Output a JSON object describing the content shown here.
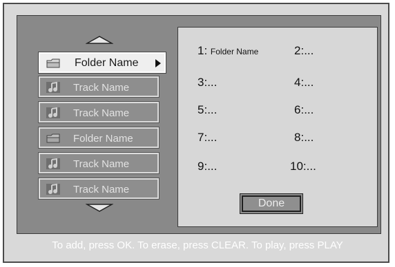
{
  "list": {
    "items": [
      {
        "type": "folder",
        "label": "Folder Name",
        "selected": true
      },
      {
        "type": "track",
        "label": "Track Name"
      },
      {
        "type": "track",
        "label": "Track Name"
      },
      {
        "type": "folder",
        "label": "Folder Name"
      },
      {
        "type": "track",
        "label": "Track Name"
      },
      {
        "type": "track",
        "label": "Track Name"
      }
    ]
  },
  "program": {
    "slots": [
      {
        "num": "1:",
        "value": "Folder Name"
      },
      {
        "num": "2:",
        "value": "..."
      },
      {
        "num": "3:",
        "value": "..."
      },
      {
        "num": "4:",
        "value": "..."
      },
      {
        "num": "5:",
        "value": "..."
      },
      {
        "num": "6:",
        "value": "..."
      },
      {
        "num": "7:",
        "value": "..."
      },
      {
        "num": "8:",
        "value": "..."
      },
      {
        "num": "9:",
        "value": "..."
      },
      {
        "num": "10:",
        "value": "..."
      }
    ],
    "done_label": "Done"
  },
  "status_text": "To add, press OK. To erase, press CLEAR. To play, press PLAY",
  "colors": {
    "background": "#898989",
    "panel": "#d7d7d7",
    "selected_item": "#efefef"
  }
}
